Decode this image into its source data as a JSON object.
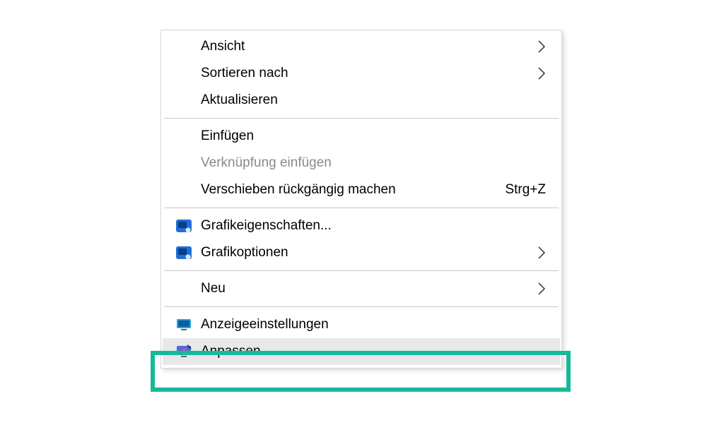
{
  "menu": {
    "items": [
      {
        "id": "view",
        "label": "Ansicht",
        "submenu": true
      },
      {
        "id": "sort",
        "label": "Sortieren nach",
        "submenu": true
      },
      {
        "id": "refresh",
        "label": "Aktualisieren"
      },
      {
        "sep": true
      },
      {
        "id": "paste",
        "label": "Einfügen"
      },
      {
        "id": "paste-link",
        "label": "Verknüpfung einfügen",
        "disabled": true
      },
      {
        "id": "undo-move",
        "label": "Verschieben rückgängig machen",
        "shortcut": "Strg+Z"
      },
      {
        "sep": true
      },
      {
        "id": "gfx-props",
        "label": "Grafikeigenschaften...",
        "icon": "intel-gfx"
      },
      {
        "id": "gfx-options",
        "label": "Grafikoptionen",
        "icon": "intel-gfx",
        "submenu": true
      },
      {
        "sep": true
      },
      {
        "id": "new",
        "label": "Neu",
        "submenu": true
      },
      {
        "sep": true
      },
      {
        "id": "display",
        "label": "Anzeigeeinstellungen",
        "icon": "display-settings"
      },
      {
        "id": "personalize",
        "label": "Anpassen",
        "icon": "personalize",
        "hovered": true
      }
    ]
  },
  "annotation": {
    "highlight_target_id": "personalize",
    "highlight_color": "#18b89a"
  }
}
